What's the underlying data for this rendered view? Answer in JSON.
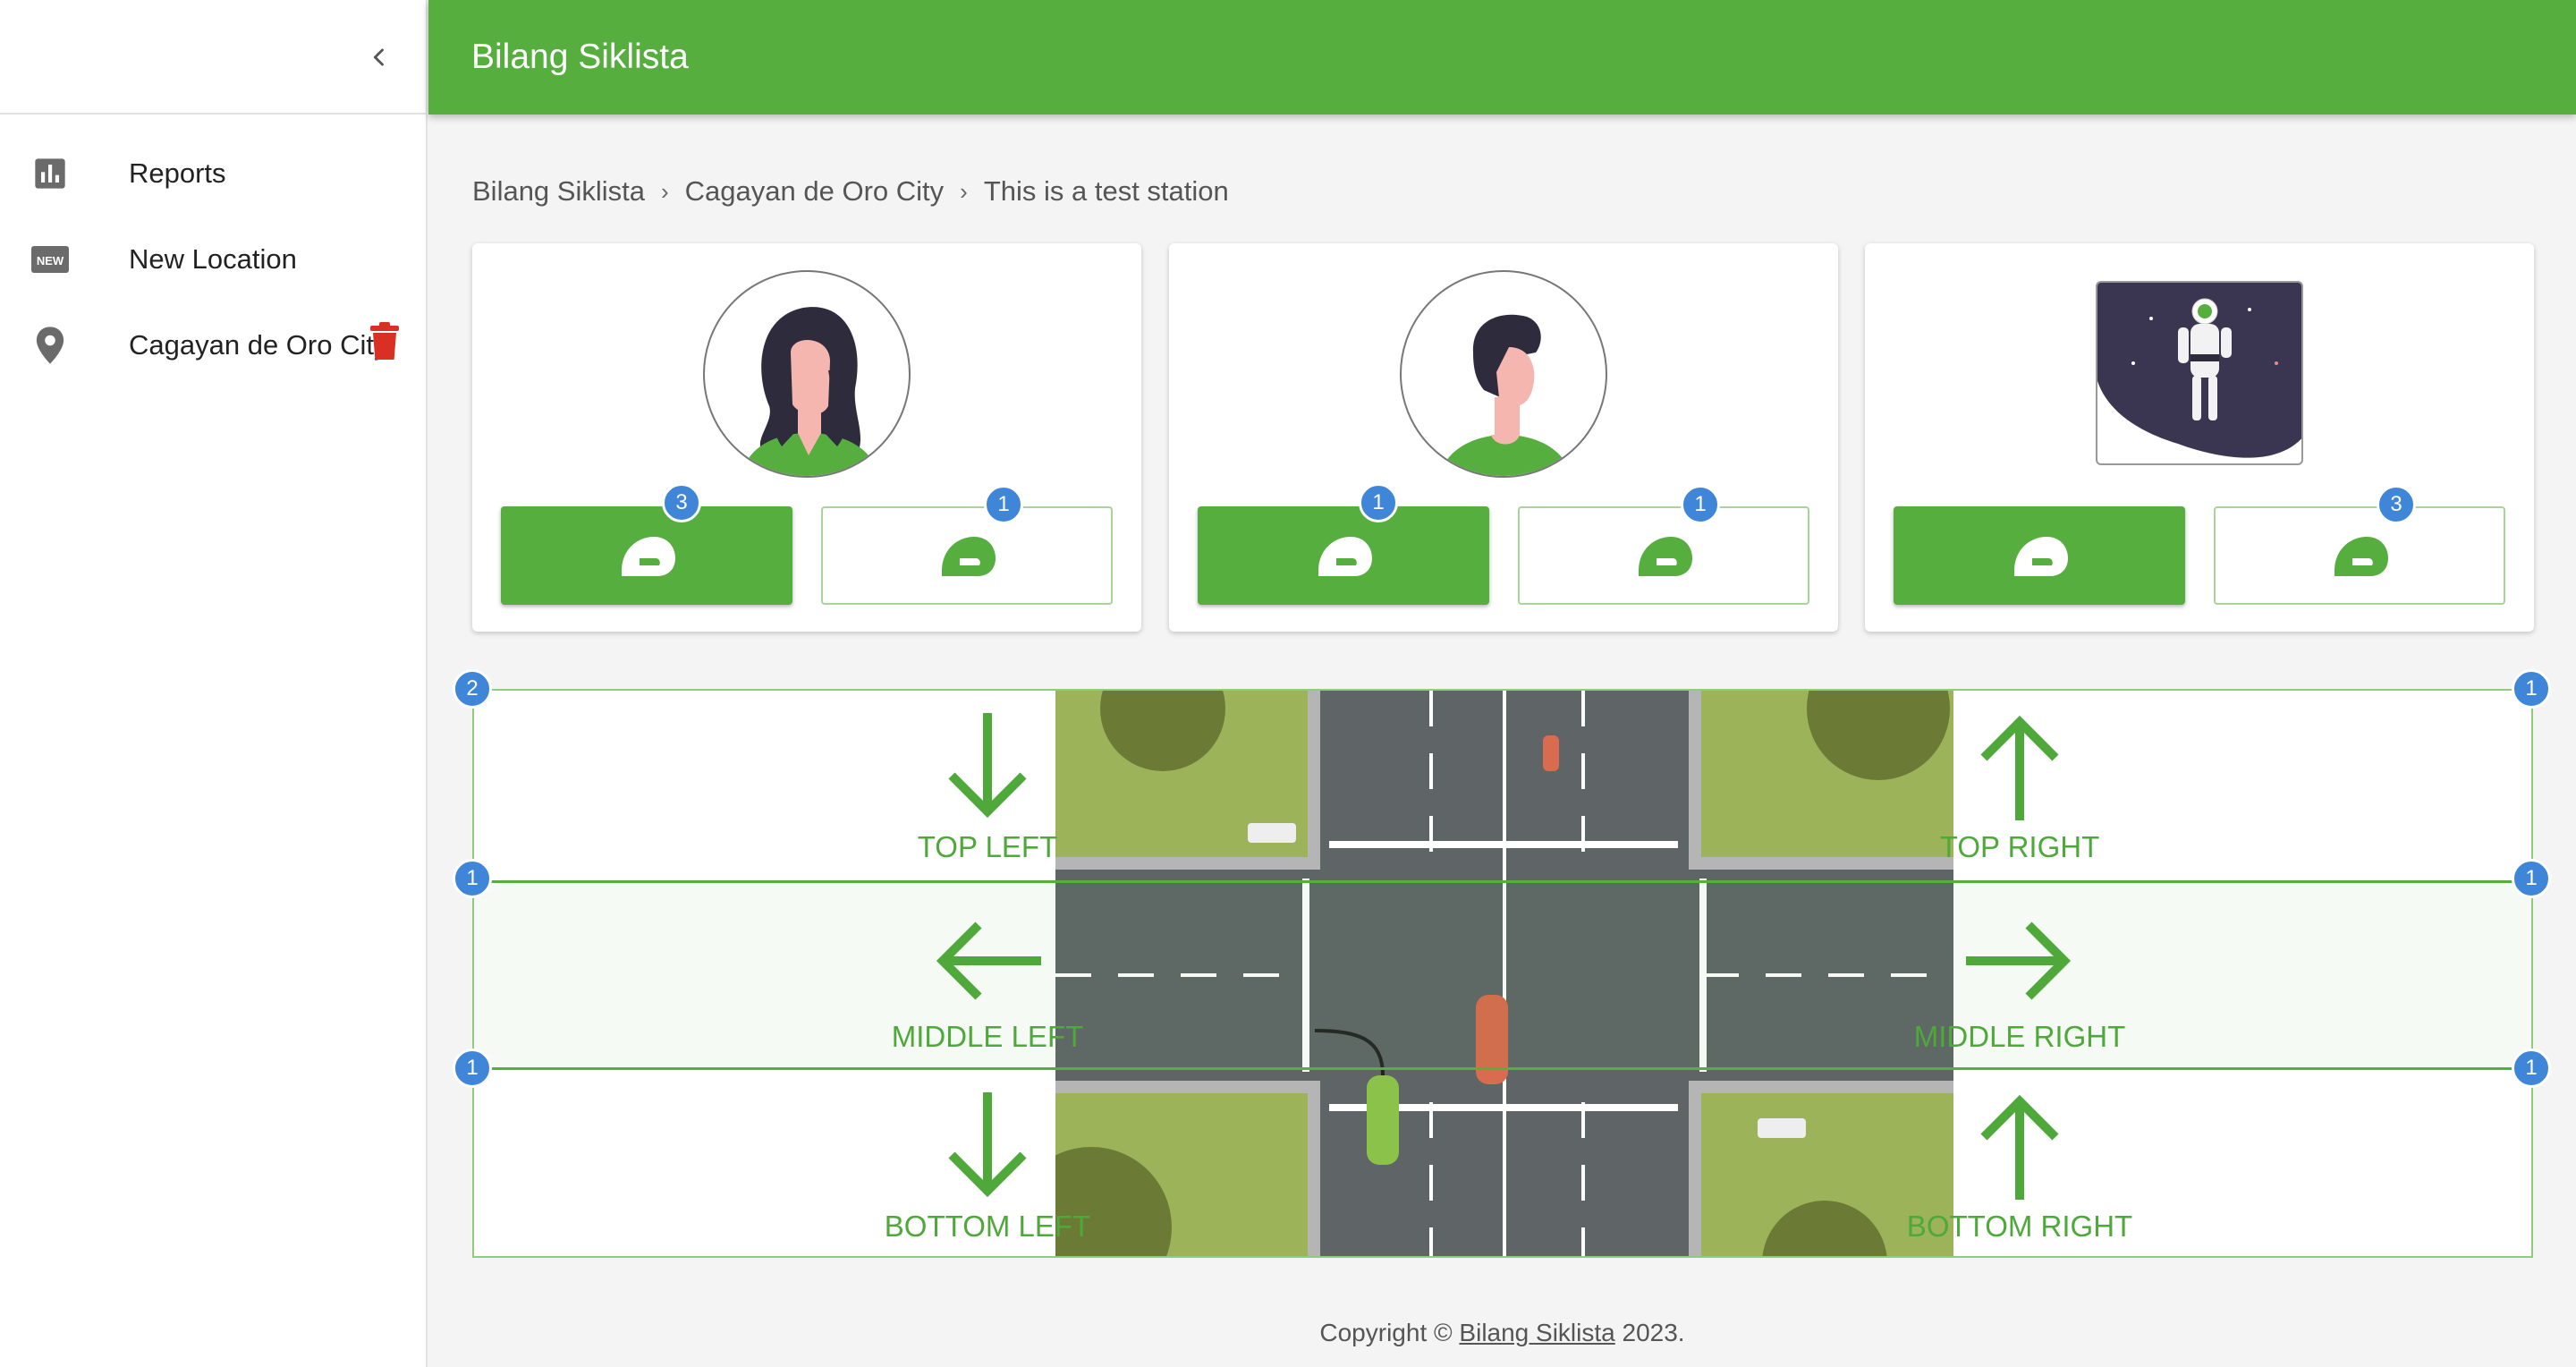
{
  "app": {
    "title": "Bilang Siklista"
  },
  "sidebar": {
    "items": [
      {
        "label": "Reports",
        "icon": "bar-chart-icon"
      },
      {
        "label": "New Location",
        "icon": "new-badge-icon"
      },
      {
        "label": "Cagayan de Oro City",
        "icon": "location-pin-icon"
      }
    ]
  },
  "breadcrumb": [
    "Bilang Siklista",
    "Cagayan de Oro City",
    "This is a test station"
  ],
  "cards": [
    {
      "avatar": "woman-avatar",
      "filled_count": "3",
      "outlined_count": "1"
    },
    {
      "avatar": "man-avatar",
      "filled_count": "1",
      "outlined_count": "1"
    },
    {
      "avatar": "astronaut-illustration",
      "filled_count": null,
      "outlined_count": "3"
    }
  ],
  "intersection": {
    "zones": {
      "top_left": "TOP LEFT",
      "top_right": "TOP RIGHT",
      "middle_left": "MIDDLE LEFT",
      "middle_right": "MIDDLE RIGHT",
      "bottom_left": "BOTTOM LEFT",
      "bottom_right": "BOTTOM RIGHT"
    },
    "badges": {
      "top_left": "2",
      "top_right": "1",
      "middle_left": "1",
      "middle_right": "1",
      "bottom_left": "1",
      "bottom_right": "1"
    }
  },
  "footer": {
    "prefix": "Copyright © ",
    "link": "Bilang Siklista",
    "suffix": " 2023."
  },
  "colors": {
    "brand": "#55ae3e",
    "badge": "#3f86d8",
    "grass": "#9db35a",
    "road": "#5f6466"
  }
}
